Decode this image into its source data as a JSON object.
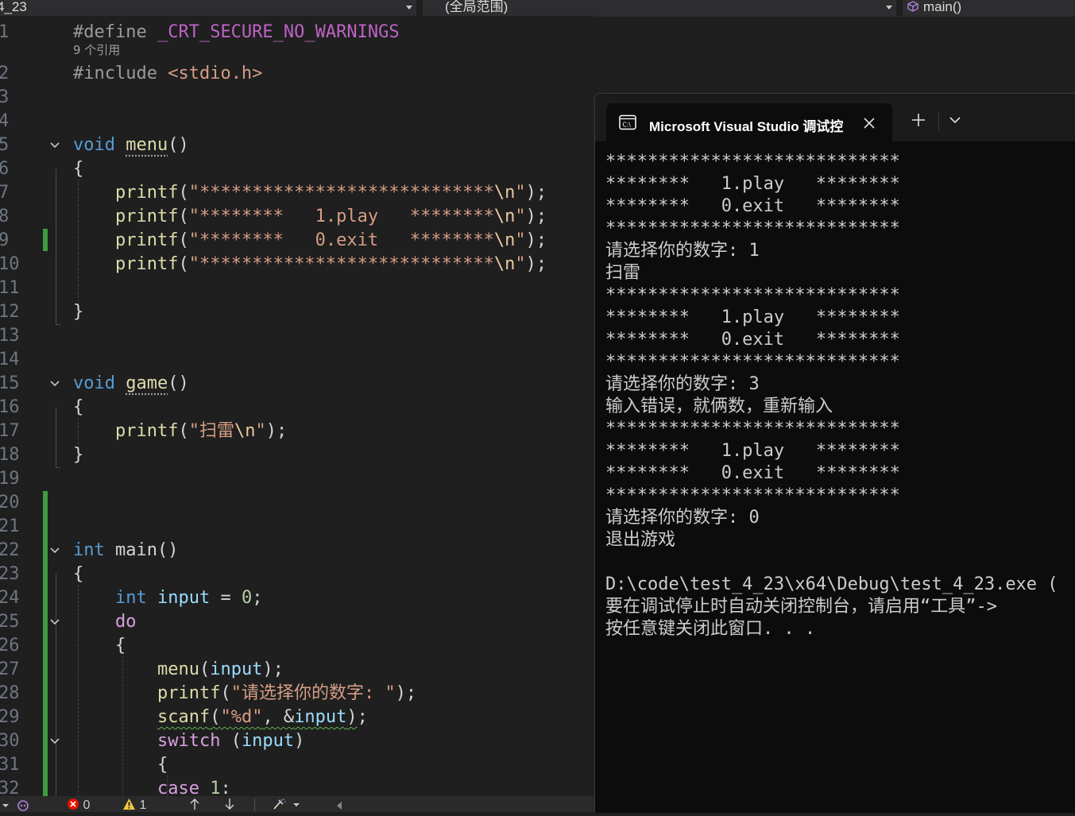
{
  "navbar": {
    "file_dropdown": "4_23",
    "scope_dropdown": "(全局范围)",
    "function_dropdown": "main()"
  },
  "editor": {
    "codelens_references": "9 个引用",
    "lines": [
      {
        "n": "1",
        "tokens": [
          [
            "pp",
            "#define "
          ],
          [
            "mac",
            "_CRT_SECURE_NO_WARNINGS"
          ]
        ]
      },
      {
        "n": "2",
        "tokens": [
          [
            "pp",
            "#include "
          ],
          [
            "str",
            "<stdio.h>"
          ]
        ]
      },
      {
        "n": "3",
        "tokens": []
      },
      {
        "n": "4",
        "tokens": []
      },
      {
        "n": "5",
        "tokens": [
          [
            "kw",
            "void "
          ],
          [
            "fn",
            "menu"
          ],
          [
            "punc",
            "()"
          ]
        ]
      },
      {
        "n": "6",
        "tokens": [
          [
            "punc",
            "{"
          ]
        ]
      },
      {
        "n": "7",
        "tokens": [
          [
            "punc",
            "    "
          ],
          [
            "fn",
            "printf"
          ],
          [
            "punc",
            "("
          ],
          [
            "str",
            "\"****************************"
          ],
          [
            "esc",
            "\\n"
          ],
          [
            "str",
            "\""
          ],
          [
            "punc",
            ");"
          ]
        ]
      },
      {
        "n": "8",
        "tokens": [
          [
            "punc",
            "    "
          ],
          [
            "fn",
            "printf"
          ],
          [
            "punc",
            "("
          ],
          [
            "str",
            "\"********   1.play   ********"
          ],
          [
            "esc",
            "\\n"
          ],
          [
            "str",
            "\""
          ],
          [
            "punc",
            ");"
          ]
        ]
      },
      {
        "n": "9",
        "tokens": [
          [
            "punc",
            "    "
          ],
          [
            "fn",
            "printf"
          ],
          [
            "punc",
            "("
          ],
          [
            "str",
            "\"********   0.exit   ********"
          ],
          [
            "esc",
            "\\n"
          ],
          [
            "str",
            "\""
          ],
          [
            "punc",
            ");"
          ]
        ]
      },
      {
        "n": "10",
        "tokens": [
          [
            "punc",
            "    "
          ],
          [
            "fn",
            "printf"
          ],
          [
            "punc",
            "("
          ],
          [
            "str",
            "\"****************************"
          ],
          [
            "esc",
            "\\n"
          ],
          [
            "str",
            "\""
          ],
          [
            "punc",
            ");"
          ]
        ]
      },
      {
        "n": "11",
        "tokens": []
      },
      {
        "n": "12",
        "tokens": [
          [
            "punc",
            "}"
          ]
        ]
      },
      {
        "n": "13",
        "tokens": []
      },
      {
        "n": "14",
        "tokens": []
      },
      {
        "n": "15",
        "tokens": [
          [
            "kw",
            "void "
          ],
          [
            "fn",
            "game"
          ],
          [
            "punc",
            "()"
          ]
        ]
      },
      {
        "n": "16",
        "tokens": [
          [
            "punc",
            "{"
          ]
        ]
      },
      {
        "n": "17",
        "tokens": [
          [
            "punc",
            "    "
          ],
          [
            "fn",
            "printf"
          ],
          [
            "punc",
            "("
          ],
          [
            "str",
            "\"扫雷"
          ],
          [
            "esc",
            "\\n"
          ],
          [
            "str",
            "\""
          ],
          [
            "punc",
            ");"
          ]
        ]
      },
      {
        "n": "18",
        "tokens": [
          [
            "punc",
            "}"
          ]
        ]
      },
      {
        "n": "19",
        "tokens": []
      },
      {
        "n": "20",
        "tokens": []
      },
      {
        "n": "21",
        "tokens": []
      },
      {
        "n": "22",
        "tokens": [
          [
            "kw",
            "int "
          ],
          [
            "punc",
            "main()"
          ]
        ]
      },
      {
        "n": "23",
        "tokens": [
          [
            "punc",
            "{"
          ]
        ]
      },
      {
        "n": "24",
        "tokens": [
          [
            "punc",
            "    "
          ],
          [
            "kw",
            "int "
          ],
          [
            "var",
            "input"
          ],
          [
            "punc",
            " = "
          ],
          [
            "num",
            "0"
          ],
          [
            "punc",
            ";"
          ]
        ]
      },
      {
        "n": "25",
        "tokens": [
          [
            "punc",
            "    "
          ],
          [
            "kw2",
            "do"
          ]
        ]
      },
      {
        "n": "26",
        "tokens": [
          [
            "punc",
            "    {"
          ]
        ]
      },
      {
        "n": "27",
        "tokens": [
          [
            "punc",
            "        "
          ],
          [
            "fn",
            "menu"
          ],
          [
            "punc",
            "("
          ],
          [
            "var",
            "input"
          ],
          [
            "punc",
            ");"
          ]
        ]
      },
      {
        "n": "28",
        "tokens": [
          [
            "punc",
            "        "
          ],
          [
            "fn",
            "printf"
          ],
          [
            "punc",
            "("
          ],
          [
            "str",
            "\"请选择你的数字: \""
          ],
          [
            "punc",
            ");"
          ]
        ]
      },
      {
        "n": "29",
        "tokens": [
          [
            "punc",
            "        "
          ],
          [
            "fnsq",
            "scanf"
          ],
          [
            "puncsq",
            "("
          ],
          [
            "strsq",
            "\"%d\""
          ],
          [
            "puncsq",
            ", &"
          ],
          [
            "varsq",
            "input"
          ],
          [
            "puncsq",
            ")"
          ],
          [
            "punc",
            ";"
          ]
        ]
      },
      {
        "n": "30",
        "tokens": [
          [
            "punc",
            "        "
          ],
          [
            "kw2",
            "switch "
          ],
          [
            "punc",
            "("
          ],
          [
            "var",
            "input"
          ],
          [
            "punc",
            ")"
          ]
        ]
      },
      {
        "n": "31",
        "tokens": [
          [
            "punc",
            "        {"
          ]
        ]
      },
      {
        "n": "32",
        "tokens": [
          [
            "punc",
            "        "
          ],
          [
            "kw2",
            "case "
          ],
          [
            "num",
            "1"
          ],
          [
            "punc",
            ":"
          ]
        ]
      }
    ]
  },
  "statusbar": {
    "errors": "0",
    "warnings": "1"
  },
  "console": {
    "tab_title": "Microsoft Visual Studio 调试控",
    "output": [
      "****************************",
      "********   1.play   ********",
      "********   0.exit   ********",
      "****************************",
      "请选择你的数字: 1",
      "扫雷",
      "****************************",
      "********   1.play   ********",
      "********   0.exit   ********",
      "****************************",
      "请选择你的数字: 3",
      "输入错误，就俩数，重新输入",
      "****************************",
      "********   1.play   ********",
      "********   0.exit   ********",
      "****************************",
      "请选择你的数字: 0",
      "退出游戏",
      "",
      "D:\\code\\test_4_23\\x64\\Debug\\test_4_23.exe (",
      "要在调试停止时自动关闭控制台，请启用“工具”->",
      "按任意键关闭此窗口. . ."
    ]
  },
  "colors": {
    "editor_bg": "#1f1f1f",
    "console_bg": "#0c0c0c",
    "keyword": "#569cd6",
    "control_keyword": "#d8a0df",
    "function": "#dcdcaa",
    "string": "#d69d85",
    "change_marker": "#3e9c3e"
  }
}
